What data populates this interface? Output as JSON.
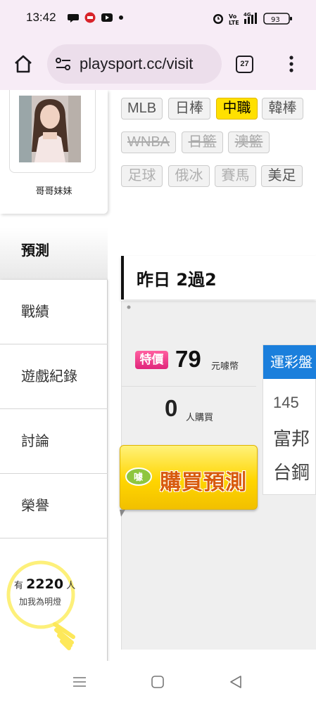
{
  "status_bar": {
    "time": "13:42",
    "battery": "93",
    "icons": [
      "chat-icon",
      "news-icon",
      "youtube-icon",
      "dot-icon",
      "alarm-icon",
      "volte-icon",
      "signal-4g-icon",
      "battery-icon"
    ]
  },
  "browser": {
    "url": "playsport.cc/visit",
    "tab_count": "27",
    "icons": [
      "home-icon",
      "site-settings-icon",
      "menu-icon"
    ]
  },
  "profile": {
    "name": "哥哥妹妹"
  },
  "tags": [
    {
      "label": "MLB",
      "state": "normal"
    },
    {
      "label": "日棒",
      "state": "normal"
    },
    {
      "label": "中職",
      "state": "active"
    },
    {
      "label": "韓棒",
      "state": "normal"
    },
    {
      "label": "WNBA",
      "state": "disabled"
    },
    {
      "label": "日籃",
      "state": "disabled"
    },
    {
      "label": "澳籃",
      "state": "disabled"
    },
    {
      "label": "足球",
      "state": "faded"
    },
    {
      "label": "俄冰",
      "state": "faded"
    },
    {
      "label": "賽馬",
      "state": "faded"
    },
    {
      "label": "美足",
      "state": "normal"
    }
  ],
  "side_nav": {
    "current": "預測",
    "items": [
      "戰績",
      "遊戲紀錄",
      "討論",
      "榮譽"
    ]
  },
  "fans": {
    "prefix": "有",
    "count": "2220",
    "suffix": "人",
    "caption": "加我為明燈"
  },
  "section": {
    "title": "昨日 2過2"
  },
  "offer": {
    "badge": "特價",
    "price": "79",
    "price_unit": "元噱幣",
    "buyers": "0",
    "buyers_unit": "人購買",
    "buy_label": "購買預測"
  },
  "game": {
    "header": "運彩盤",
    "number": "145",
    "teams": [
      "富邦",
      "台鋼"
    ]
  },
  "colors": {
    "active_tag": "#ffe000",
    "special_badge": "#e0257b",
    "game_header": "#1b7fdc",
    "buy_button": "#ffd500",
    "chrome_bg": "#f7ecf6"
  }
}
